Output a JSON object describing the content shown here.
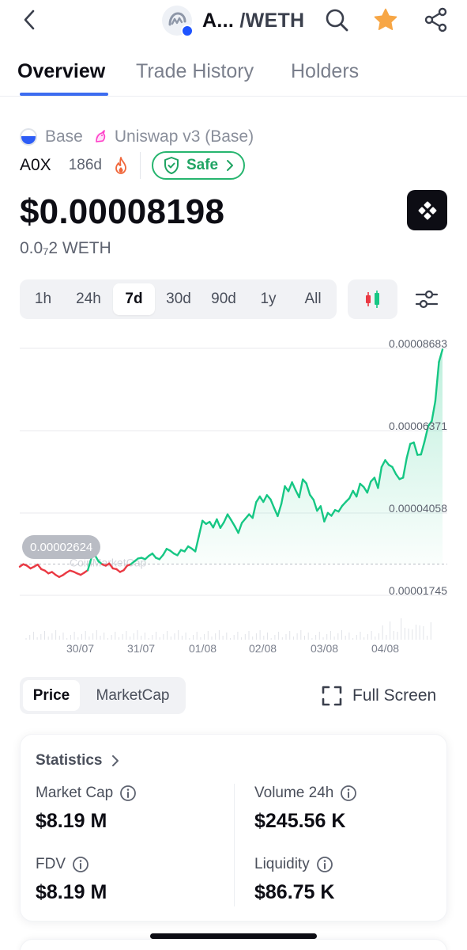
{
  "header": {
    "token_short": "A...",
    "pair_quote": "/WETH",
    "icons": [
      "chevron-left-icon",
      "search-icon",
      "star-icon",
      "share-icon"
    ],
    "star_color": "#f7a645"
  },
  "tabs": [
    "Overview",
    "Trade History",
    "Holders"
  ],
  "active_tab": "Overview",
  "chain": {
    "network": "Base",
    "dex": "Uniswap v3 (Base)",
    "symbol": "A0X",
    "age": "186d",
    "safety_label": "Safe"
  },
  "price": {
    "usd": "$0.00008198",
    "weth": "0.0₇2 WETH"
  },
  "timeframes": [
    "1h",
    "24h",
    "7d",
    "30d",
    "90d",
    "1y",
    "All"
  ],
  "active_timeframe": "7d",
  "chart_data": {
    "type": "area",
    "y_tick_labels": [
      "0.00008683",
      "0.00006371",
      "0.00004058",
      "0.00001745"
    ],
    "y_ticks": [
      8.683e-05,
      6.371e-05,
      4.058e-05,
      1.745e-05
    ],
    "x_tick_labels": [
      "30/07",
      "31/07",
      "01/08",
      "02/08",
      "03/08",
      "04/08"
    ],
    "start_price_label": "0.00002624",
    "start_price": 2.624e-05,
    "watermark": "CoinMarketCap",
    "colors": {
      "up": "#16c784",
      "down": "#ea3943"
    },
    "series": [
      {
        "values": [
          2.55e-05,
          2.62e-05,
          2.58e-05,
          2.5e-05,
          2.55e-05,
          2.61e-05,
          2.48e-05,
          2.44e-05,
          2.36e-05,
          2.4e-05,
          2.32e-05,
          2.26e-05,
          2.31e-05,
          2.38e-05,
          2.44e-05,
          2.41e-05,
          2.36e-05,
          2.32e-05,
          2.38e-05,
          2.45e-05,
          2.8e-05,
          2.87e-05,
          2.7e-05,
          2.62e-05,
          2.58e-05,
          2.64e-05,
          2.5e-05,
          2.48e-05,
          2.4e-05,
          2.45e-05,
          2.58e-05,
          2.62e-05,
          2.7e-05,
          2.78e-05,
          2.8e-05,
          2.76e-05,
          2.85e-05,
          2.92e-05,
          2.8e-05,
          2.76e-05,
          2.88e-05,
          3.05e-05,
          3e-05,
          2.92e-05,
          2.87e-05,
          3.02e-05,
          2.98e-05,
          3.12e-05,
          3.06e-05,
          2.98e-05,
          3.41e-05,
          3.84e-05,
          3.75e-05,
          3.81e-05,
          3.65e-05,
          3.88e-05,
          3.64e-05,
          3.8e-05,
          4.02e-05,
          3.86e-05,
          3.69e-05,
          3.5e-05,
          3.78e-05,
          3.9e-05,
          4.02e-05,
          3.92e-05,
          4.36e-05,
          4.52e-05,
          4.37e-05,
          4.56e-05,
          4.44e-05,
          4.2e-05,
          3.97e-05,
          4.31e-05,
          4.81e-05,
          4.67e-05,
          4.92e-05,
          4.7e-05,
          4.5e-05,
          5e-05,
          4.89e-05,
          4.57e-05,
          4.43e-05,
          4.12e-05,
          4.25e-05,
          3.82e-05,
          4.06e-05,
          3.98e-05,
          4.14e-05,
          4.1e-05,
          4.26e-05,
          4.37e-05,
          4.47e-05,
          4.68e-05,
          4.52e-05,
          4.88e-05,
          4.79e-05,
          4.63e-05,
          4.94e-05,
          5.05e-05,
          4.76e-05,
          5.35e-05,
          5.54e-05,
          5.41e-05,
          5.35e-05,
          5.15e-05,
          5.01e-05,
          5.05e-05,
          5.6e-05,
          6e-05,
          6.04e-05,
          5.69e-05,
          5.7e-05,
          6.07e-05,
          6.5e-05,
          6.64e-05,
          7.2e-05,
          8.3e-05,
          8.65e-05
        ]
      }
    ]
  },
  "chart_toggle": [
    "Price",
    "MarketCap"
  ],
  "active_chart_toggle": "Price",
  "full_screen_label": "Full Screen",
  "statistics": {
    "title": "Statistics",
    "items": [
      {
        "label": "Market Cap",
        "value": "$8.19 M"
      },
      {
        "label": "Volume 24h",
        "value": "$245.56 K"
      },
      {
        "label": "FDV",
        "value": "$8.19 M"
      },
      {
        "label": "Liquidity",
        "value": "$86.75 K"
      }
    ]
  }
}
